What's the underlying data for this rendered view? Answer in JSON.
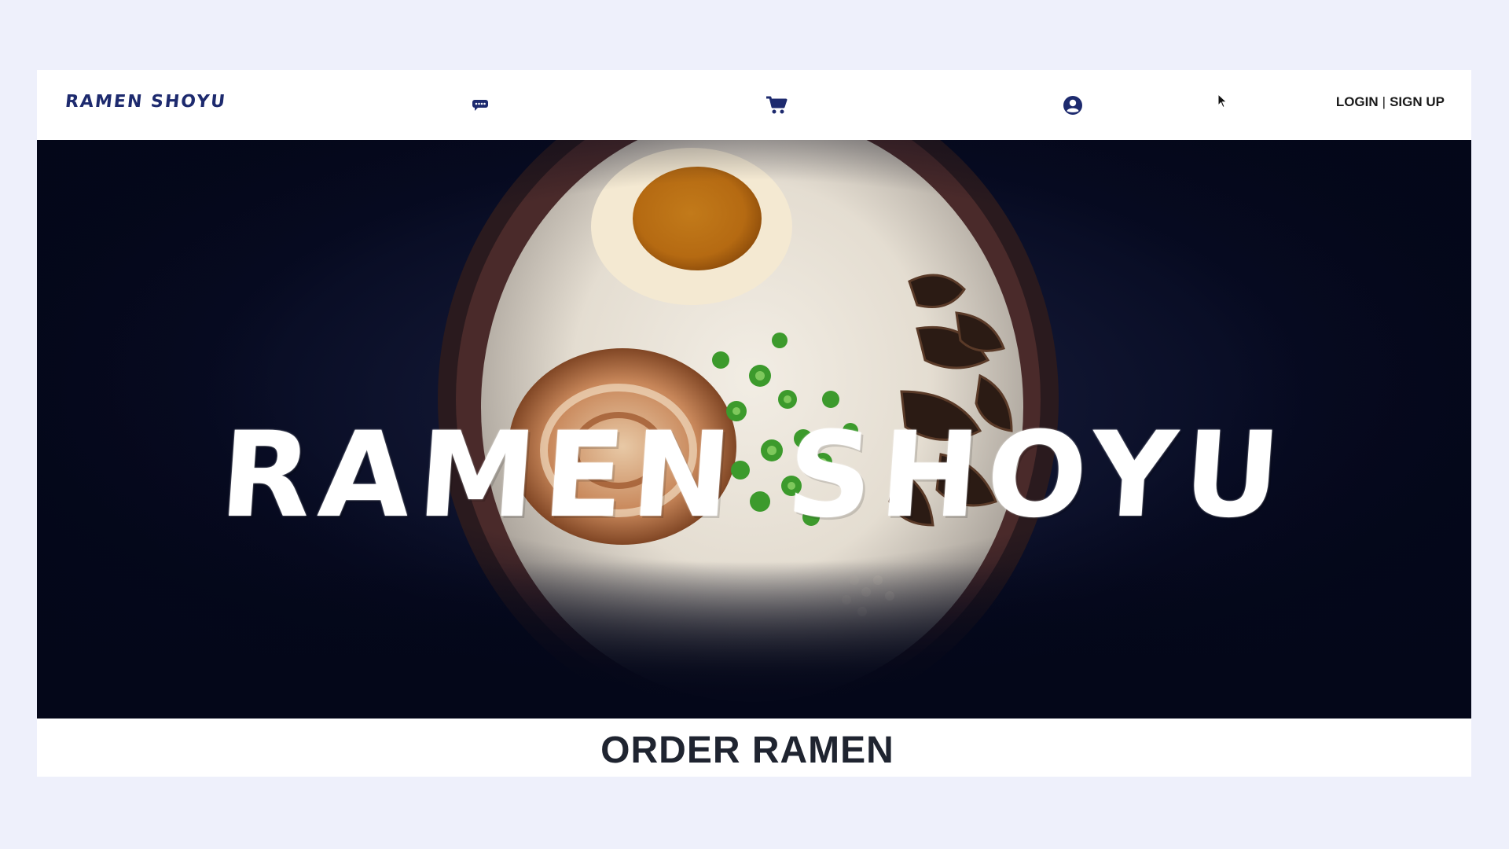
{
  "header": {
    "logo": "RAMEN SHOYU",
    "icons": {
      "chat": "chat-icon",
      "cart": "cart-icon",
      "account": "account-icon"
    },
    "login_label": "LOGIN",
    "separator": "|",
    "signup_label": "SIGN UP"
  },
  "hero": {
    "title": "RAMEN SHOYU"
  },
  "section": {
    "title": "ORDER RAMEN"
  },
  "colors": {
    "brand": "#1d2a6e",
    "background": "#eef0fb",
    "hero_dark": "#040719"
  }
}
